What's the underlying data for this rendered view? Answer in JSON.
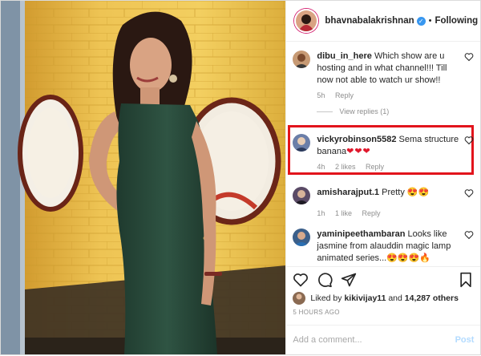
{
  "colors": {
    "accent": "#3897f0",
    "highlight_box": "#e2141c",
    "heart_red": "#e0182c",
    "muted_text": "#8e8e8e",
    "post_button_disabled": "#b3dbff"
  },
  "header": {
    "username": "bhavnabalakrishnan",
    "verified": true,
    "separator": "•",
    "follow_label": "Following"
  },
  "comments": [
    {
      "username": "dibu_in_here",
      "text": "Which show are u hosting and in what channel!!! Till now not able to watch ur show!!",
      "time": "5h",
      "reply_label": "Reply",
      "view_replies": "View replies (1)"
    },
    {
      "username": "vickyrobinson5582",
      "text": "Sema structure banana",
      "emoji": "❤❤❤",
      "time": "4h",
      "likes": "2 likes",
      "reply_label": "Reply",
      "highlighted": true
    },
    {
      "username": "amisharajput.1",
      "text": "Pretty",
      "emoji": "😍😍",
      "time": "1h",
      "likes": "1 like",
      "reply_label": "Reply"
    },
    {
      "username": "yaminipeethambaran",
      "text": "Looks like jasmine from alauddin magic lamp animated series...",
      "emoji": "😍😍😍🔥",
      "icons": [
        "heart-icon"
      ]
    }
  ],
  "actions": {
    "icons": [
      "heart-icon",
      "comment-icon",
      "share-icon",
      "bookmark-icon"
    ]
  },
  "likes": {
    "prefix": "Liked by",
    "user": "kikivijay11",
    "joiner": "and",
    "count": "14,287 others"
  },
  "time_ago": "5 HOURS AGO",
  "add_comment": {
    "placeholder": "Add a comment...",
    "post_label": "Post"
  }
}
